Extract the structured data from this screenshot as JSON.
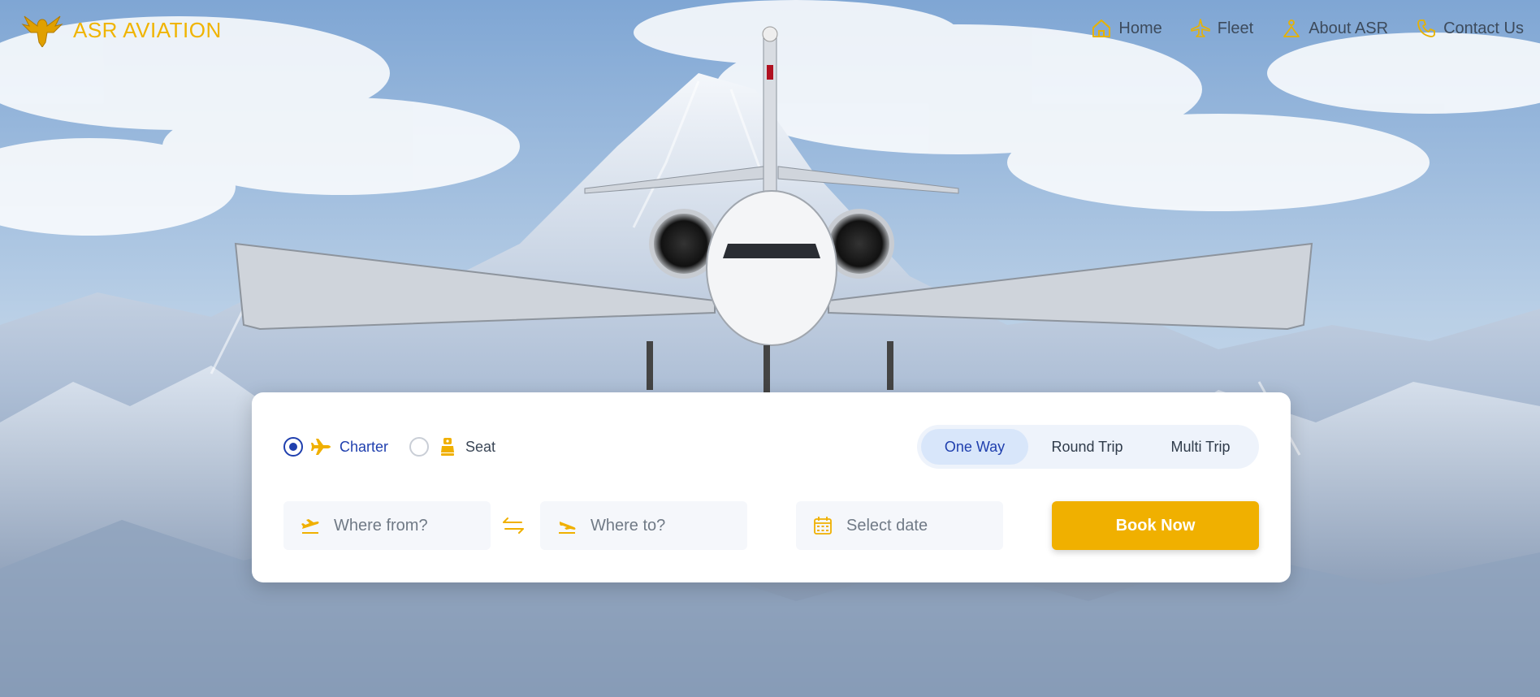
{
  "brand": {
    "name": "ASR AVIATION",
    "logo_icon": "eagle-logo"
  },
  "nav": [
    {
      "label": "Home",
      "icon": "home-icon"
    },
    {
      "label": "Fleet",
      "icon": "plane-icon"
    },
    {
      "label": "About ASR",
      "icon": "triangle-person-icon"
    },
    {
      "label": "Contact Us",
      "icon": "phone-icon"
    }
  ],
  "booking": {
    "modes": [
      {
        "label": "Charter",
        "selected": true,
        "icon": "airplane-icon"
      },
      {
        "label": "Seat",
        "selected": false,
        "icon": "seat-icon"
      }
    ],
    "trip_types": [
      {
        "label": "One Way",
        "active": true
      },
      {
        "label": "Round Trip",
        "active": false
      },
      {
        "label": "Multi Trip",
        "active": false
      }
    ],
    "from_placeholder": "Where from?",
    "to_placeholder": "Where to?",
    "date_placeholder": "Select date",
    "book_label": "Book Now"
  },
  "colors": {
    "accent": "#f0b000",
    "primary": "#1f3fae",
    "text": "#3d4b5c"
  }
}
